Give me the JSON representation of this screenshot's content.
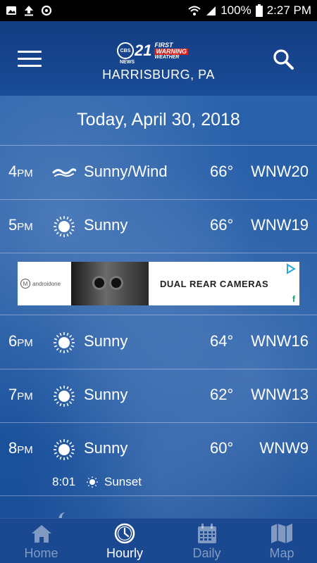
{
  "status_bar": {
    "battery_percent": "100%",
    "time": "2:27 PM"
  },
  "header": {
    "logo": {
      "number": "21",
      "network": "CBS",
      "news": "NEWS",
      "first": "FIRST",
      "warning": "WARNING",
      "weather": "WEATHER"
    },
    "location": "HARRISBURG, PA"
  },
  "date_heading": "Today, April 30, 2018",
  "hours": [
    {
      "hour": "4",
      "ampm": "PM",
      "icon": "wind-icon",
      "condition": "Sunny/Wind",
      "temp": "66°",
      "wind": "WNW20"
    },
    {
      "hour": "5",
      "ampm": "PM",
      "icon": "sun-icon",
      "condition": "Sunny",
      "temp": "66°",
      "wind": "WNW19"
    },
    {
      "hour": "6",
      "ampm": "PM",
      "icon": "sun-icon",
      "condition": "Sunny",
      "temp": "64°",
      "wind": "WNW16"
    },
    {
      "hour": "7",
      "ampm": "PM",
      "icon": "sun-icon",
      "condition": "Sunny",
      "temp": "62°",
      "wind": "WNW13"
    },
    {
      "hour": "8",
      "ampm": "PM",
      "icon": "sun-icon",
      "condition": "Sunny",
      "temp": "60°",
      "wind": "WNW9"
    }
  ],
  "sunset": {
    "time": "8:01",
    "label": "Sunset"
  },
  "ad": {
    "brand": "androidone",
    "headline": "DUAL REAR CAMERAS"
  },
  "nav": {
    "items": [
      {
        "label": "Home",
        "icon": "home-icon",
        "active": false
      },
      {
        "label": "Hourly",
        "icon": "clock-icon",
        "active": true
      },
      {
        "label": "Daily",
        "icon": "calendar-icon",
        "active": false
      },
      {
        "label": "Map",
        "icon": "map-icon",
        "active": false
      }
    ]
  },
  "colors": {
    "header_bg": "#123c82",
    "content_bg": "#2a62ab",
    "nav_bg": "#1a4891",
    "warning_red": "#d41f1f"
  }
}
